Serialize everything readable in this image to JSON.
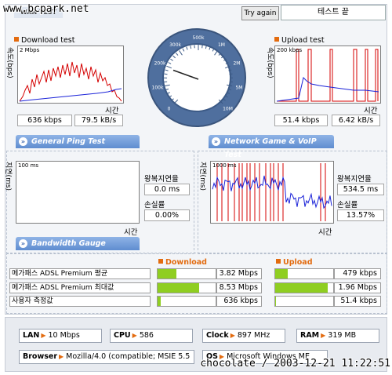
{
  "watermark_top": "www.bcpark.net",
  "watermark_bottom": "chocolate / 2003-12-21 11:22:51",
  "header": {
    "title": "WAN TEST",
    "try_again": "Try again",
    "banner": "테스트 끝"
  },
  "download": {
    "label": "Download test",
    "axis_y": "속도(bps)",
    "scale": "2 Mbps",
    "axis_x": "시간",
    "kbps": "636 kbps",
    "kBs": "79.5 kB/s"
  },
  "upload": {
    "label": "Upload test",
    "axis_y": "속도(bps)",
    "scale": "200 kbps",
    "axis_x": "시간",
    "kbps": "51.4 kbps",
    "kBs": "6.42 kB/s"
  },
  "gauge": {
    "ticks": [
      "0",
      "100k",
      "200k",
      "300k",
      "500k",
      "1M",
      "2M",
      "5M",
      "10M"
    ],
    "speed_fraction": 0.24
  },
  "ping": {
    "tab": "General Ping Test",
    "axis_y": "지연(ms)",
    "scale": "100 ms",
    "axis_x": "시간",
    "latency_label": "왕복지연율",
    "latency": "0.0 ms",
    "loss_label": "손실률",
    "loss": "0.00%"
  },
  "game": {
    "tab": "Network Game & VoIP Test",
    "axis_y": "지연(ms)",
    "scale": "1000 ms",
    "axis_x": "시간",
    "latency_label": "왕복지연율",
    "latency": "534.5 ms",
    "loss_label": "손실률",
    "loss": "13.57%"
  },
  "bandwidth": {
    "tab": "Bandwidth Gauge",
    "download_head": "Download",
    "upload_head": "Upload",
    "rows": [
      {
        "name": "메가패스 ADSL Premium 평균",
        "down": "3.82 Mbps",
        "down_fill": 0.32,
        "up": "479 kbps",
        "up_fill": 0.22
      },
      {
        "name": "메가패스 ADSL Premium 최대값",
        "down": "8.53 Mbps",
        "down_fill": 0.72,
        "up": "1.96 Mbps",
        "up_fill": 0.9
      },
      {
        "name": "사용자 측정값",
        "down": "636 kbps",
        "down_fill": 0.05,
        "up": "51.4 kbps",
        "up_fill": 0.02
      }
    ]
  },
  "system": {
    "lan_label": "LAN",
    "lan": "10 Mbps",
    "cpu_label": "CPU",
    "cpu": "586",
    "clock_label": "Clock",
    "clock": "897 MHz",
    "ram_label": "RAM",
    "ram": "319 MB",
    "browser_label": "Browser",
    "browser": "Mozilla/4.0 (compatible; MSIE 5.5",
    "os_label": "OS",
    "os": "Microsoft Windows ME"
  },
  "colors": {
    "accent": "#e36b0f",
    "tab_blue": "#5f8dd0",
    "bar_green": "#8fce21",
    "series_red": "#d40000",
    "series_blue": "#1a22d8"
  }
}
